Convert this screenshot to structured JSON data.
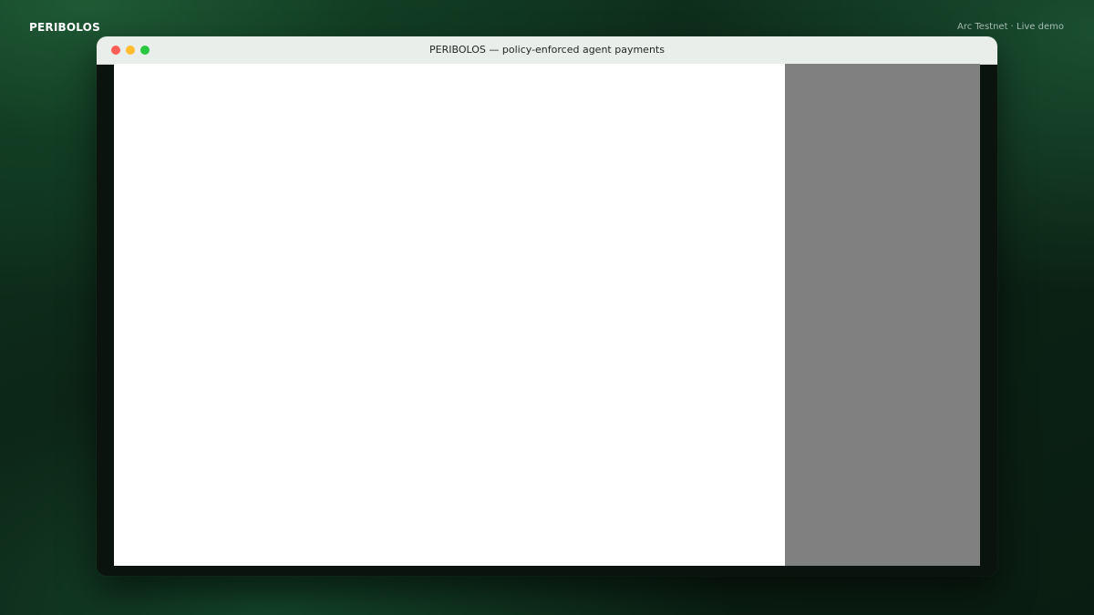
{
  "header": {
    "brand": "PERIBOLOS",
    "network": "Arc Testnet · Live demo"
  },
  "window": {
    "title": "PERIBOLOS — policy-enforced agent payments",
    "controls": [
      "close",
      "minimize",
      "maximize"
    ]
  },
  "colors": {
    "background": "#0c2416",
    "titlebar": "#eaeeea",
    "main_pane": "#ffffff",
    "side_pane": "#808080",
    "close": "#ff5f57",
    "minimize": "#febc2e",
    "maximize": "#28c840"
  }
}
